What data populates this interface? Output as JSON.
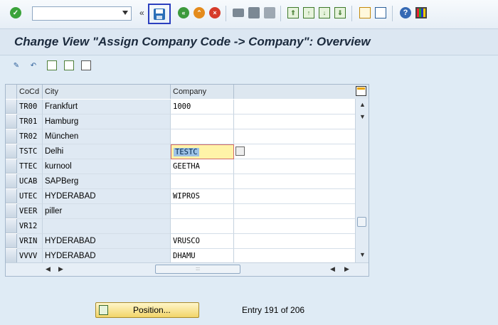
{
  "title": "Change View \"Assign Company Code -> Company\": Overview",
  "toolbar": {
    "command_field_value": "",
    "more_symbol": "«"
  },
  "table": {
    "columns": [
      "CoCd",
      "City",
      "Company"
    ],
    "rows": [
      {
        "cocd": "TR00",
        "city": "Frankfurt",
        "company": "1000"
      },
      {
        "cocd": "TR01",
        "city": "Hamburg",
        "company": ""
      },
      {
        "cocd": "TR02",
        "city": "München",
        "company": ""
      },
      {
        "cocd": "TSTC",
        "city": "Delhi",
        "company": "TESTC"
      },
      {
        "cocd": "TTEC",
        "city": "kurnool",
        "company": "GEETHA"
      },
      {
        "cocd": "UCAB",
        "city": "SAPBerg",
        "company": ""
      },
      {
        "cocd": "UTEC",
        "city": "HYDERABAD",
        "company": "WIPROS"
      },
      {
        "cocd": "VEER",
        "city": "piller",
        "company": ""
      },
      {
        "cocd": "VR12",
        "city": "",
        "company": ""
      },
      {
        "cocd": "VRIN",
        "city": "HYDERABAD",
        "company": "VRUSCO"
      },
      {
        "cocd": "VVVV",
        "city": "HYDERABAD",
        "company": "DHAMU"
      }
    ]
  },
  "footer": {
    "position_button": "Position...",
    "entry_text": "Entry 191 of 206"
  }
}
